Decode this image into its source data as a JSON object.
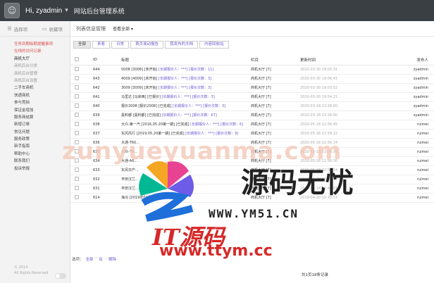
{
  "topbar": {
    "greeting": "Hi, zyadmin",
    "system_title": "网站后台管理系统"
  },
  "sidebar": {
    "tabs": [
      "选择项",
      "收藏项"
    ],
    "items": [
      {
        "label": "任务到期临期提醒事项",
        "style": "red"
      },
      {
        "label": "在线的访问记录",
        "style": "red"
      },
      {
        "label": "商机大厅",
        "style": "hl"
      },
      {
        "label": "商机后台分类",
        "style": "grey"
      },
      {
        "label": "商机后台管理",
        "style": "grey"
      },
      {
        "label": "商机后台设置",
        "style": "grey"
      },
      {
        "label": "二手车商机",
        "style": ""
      },
      {
        "label": "快递商机",
        "style": ""
      },
      {
        "label": "参与竞拍",
        "style": ""
      },
      {
        "label": "保证金增加",
        "style": ""
      },
      {
        "label": "服务商结算",
        "style": ""
      },
      {
        "label": "新增订单",
        "style": ""
      },
      {
        "label": "常见问题",
        "style": ""
      },
      {
        "label": "服务政策",
        "style": ""
      },
      {
        "label": "新手指南",
        "style": ""
      },
      {
        "label": "帮助中心",
        "style": ""
      },
      {
        "label": "联系我们",
        "style": ""
      },
      {
        "label": "投诉举报",
        "style": ""
      }
    ],
    "footer": [
      "© 2014",
      "All Rights Reserved"
    ]
  },
  "main": {
    "tab_active": "列表信息管理",
    "tab_dropdown": "查看全部 ▾",
    "filters": [
      "全部",
      "来客",
      "日常",
      "首页滚动报告",
      "我发布的文档",
      "内容回收站"
    ],
    "columns": [
      "",
      "ID",
      "标题",
      "栏目",
      "更新时间",
      "发布人"
    ],
    "rows": [
      {
        "id": "644",
        "title": "5008 [3008] [未开始] ",
        "status": "[长期报价人：***] [报价次数：11]",
        "cat": "商机大厅 [7]",
        "time": "2020-03-30 19:05:31",
        "user": "zyadmin"
      },
      {
        "id": "643",
        "title": "4009 [4009] [未开始] ",
        "status": "[长期报价人：***] [报价次数：3]",
        "cat": "商机大厅 [7]",
        "time": "2020-03-30 19:06:41",
        "user": "zyadmin"
      },
      {
        "id": "642",
        "title": "3009 [3009] [未开始] ",
        "status": "[长期报价人：***] [报价次数：3]",
        "cat": "商机大厅 [7]",
        "time": "2020-03-30 19:03:52",
        "user": "zyadmin"
      },
      {
        "id": "641",
        "title": "马里达 [马来西] [已报价] ",
        "status": "[长期报价人：***] [报价次数：3]",
        "cat": "商机大厅 [7]",
        "time": "2020-03-20 19:54:21",
        "user": "zyadmin"
      },
      {
        "id": "640",
        "title": "报价2008 [报价2008] [已完成] ",
        "status": "[长期报价人：***] [报价次数：3]",
        "cat": "商机大厅 [7]",
        "time": "2020-03-18 22:28:00",
        "user": "zyadmin"
      },
      {
        "id": "639",
        "title": "黑料都 [黑料都] [已完成] ",
        "status": "[长期报价人：***] [报价次数：67]",
        "cat": "商机大厅 [7]",
        "time": "2020-03-18 22:26:00",
        "user": "zyadmin"
      },
      {
        "id": "638",
        "title": "大众-第一汽 [2016.05.20第一期] [已完成] ",
        "status": "[长期报价人：***] [报价次数：6]",
        "cat": "商机大厅 [7]",
        "time": "2020-05-18 22:56:45",
        "user": "ruimei"
      },
      {
        "id": "637",
        "title": "东风风行 [2019.05.20第一期] [已完成] ",
        "status": "[长期报价人：***] [报价次数：9]",
        "cat": "商机大厅 [7]",
        "time": "2020-05-18 22:59:22",
        "user": "ruimei"
      },
      {
        "id": "636",
        "title": "大通-T60...",
        "status": "",
        "cat": "商机大厅 [7]",
        "time": "2020-05-18 22:56:14",
        "user": "ruimei"
      },
      {
        "id": "635",
        "title": "大众-T6...",
        "status": "",
        "cat": "商机大厅 [7]",
        "time": "2020-05-18 22:56:36",
        "user": "ruimei"
      },
      {
        "id": "634",
        "title": "大通-A6...",
        "status": "",
        "cat": "商机大厅 [7]",
        "time": "2020-05-18 22:56:30",
        "user": "ruimei"
      },
      {
        "id": "633",
        "title": "东风日产...",
        "status": "",
        "cat": "商机大厅 [7]",
        "time": "2020-05-18 22:55:14",
        "user": "ruimei"
      },
      {
        "id": "632",
        "title": "丰田汉兰...",
        "status": "",
        "cat": "商机大厅 [7]",
        "time": "2020-05-18 22:55:18",
        "user": "ruimei"
      },
      {
        "id": "631",
        "title": "丰田汉兰...",
        "status": "",
        "cat": "商机大厅 [7]",
        "time": "2020-05-18 22:46:31",
        "user": "ruimei"
      },
      {
        "id": "614",
        "title": "海马 [2019年04月20日第一期] [已完成]",
        "status": "",
        "cat": "商机大厅 [7]",
        "time": "2019-04-20 15:10:53",
        "user": "ruimei"
      }
    ],
    "pager": {
      "label": "选项：",
      "all": "全部",
      "sep": "-",
      "reverse": "反",
      "delete": "删除"
    },
    "page_info": "共1页18条记录"
  },
  "watermarks": {
    "domain1": "zunyueyuanma.com",
    "brand_cn": "源码无忧",
    "domain2": "WWW.YM51.CN",
    "it_brand": "IT源码",
    "domain3": "www.ttym.cc"
  }
}
